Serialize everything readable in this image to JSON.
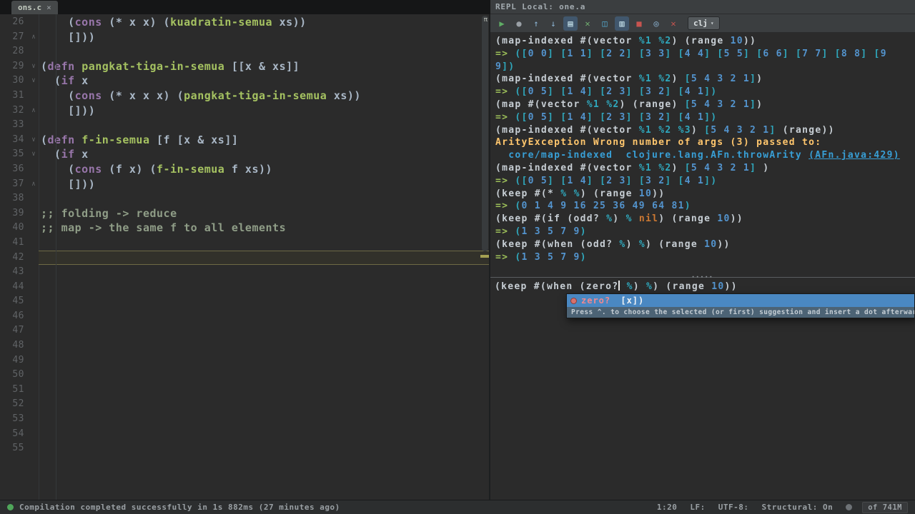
{
  "topbar": {
    "tab": {
      "label": "ons.c",
      "close": "×"
    }
  },
  "repl_header": {
    "title": "REPL Local: one.a"
  },
  "editor": {
    "lines": [
      {
        "n": 26,
        "seg": [
          [
            "    (",
            "d"
          ],
          [
            "cons",
            "kw"
          ],
          [
            " (* x x) (",
            "d"
          ],
          [
            "kuadratin-semua",
            "fn"
          ],
          [
            " xs))",
            "d"
          ]
        ]
      },
      {
        "n": 27,
        "f": "e",
        "seg": [
          [
            "    []))",
            "d"
          ]
        ]
      },
      {
        "n": 28
      },
      {
        "n": 29,
        "f": "s",
        "seg": [
          [
            "(",
            "d"
          ],
          [
            "defn",
            "kw"
          ],
          [
            " ",
            "d"
          ],
          [
            "pangkat-tiga-in-semua",
            "fn"
          ],
          [
            " [[x & xs]]",
            "d"
          ]
        ]
      },
      {
        "n": 30,
        "f": "s",
        "seg": [
          [
            "  (",
            "d"
          ],
          [
            "if",
            "kw"
          ],
          [
            " x",
            "d"
          ]
        ]
      },
      {
        "n": 31,
        "seg": [
          [
            "    (",
            "d"
          ],
          [
            "cons",
            "kw"
          ],
          [
            " (* x x x) (",
            "d"
          ],
          [
            "pangkat-tiga-in-semua",
            "fn"
          ],
          [
            " xs))",
            "d"
          ]
        ]
      },
      {
        "n": 32,
        "f": "e",
        "seg": [
          [
            "    []))",
            "d"
          ]
        ]
      },
      {
        "n": 33
      },
      {
        "n": 34,
        "f": "s",
        "seg": [
          [
            "(",
            "d"
          ],
          [
            "defn",
            "kw"
          ],
          [
            " ",
            "d"
          ],
          [
            "f-in-semua",
            "fn"
          ],
          [
            " [f [x & xs]]",
            "d"
          ]
        ]
      },
      {
        "n": 35,
        "f": "s",
        "seg": [
          [
            "  (",
            "d"
          ],
          [
            "if",
            "kw"
          ],
          [
            " x",
            "d"
          ]
        ]
      },
      {
        "n": 36,
        "seg": [
          [
            "    (",
            "d"
          ],
          [
            "cons",
            "kw"
          ],
          [
            " (f x) (",
            "d"
          ],
          [
            "f-in-semua",
            "fn"
          ],
          [
            " f xs))",
            "d"
          ]
        ]
      },
      {
        "n": 37,
        "f": "e",
        "seg": [
          [
            "    []))",
            "d"
          ]
        ]
      },
      {
        "n": 38
      },
      {
        "n": 39,
        "seg": [
          [
            ";; folding -> reduce",
            "cm"
          ]
        ]
      },
      {
        "n": 40,
        "seg": [
          [
            ";; map -> the same f to all elements",
            "cm"
          ]
        ]
      },
      {
        "n": 41
      },
      {
        "n": 42,
        "cur": true
      },
      {
        "n": 43
      },
      {
        "n": 44
      },
      {
        "n": 45
      },
      {
        "n": 46
      },
      {
        "n": 47
      },
      {
        "n": 48
      },
      {
        "n": 49
      },
      {
        "n": 50
      },
      {
        "n": 51
      },
      {
        "n": 52
      },
      {
        "n": 53
      },
      {
        "n": 54
      },
      {
        "n": 55
      }
    ]
  },
  "repl": {
    "toolbar": [
      {
        "name": "run-icon",
        "glyph": "▶",
        "color": "#5fad65"
      },
      {
        "name": "pause-icon",
        "glyph": "●",
        "color": "#9aa0a6"
      },
      {
        "name": "history-previous-icon",
        "glyph": "↑",
        "color": "#8fb8d8"
      },
      {
        "name": "history-next-icon",
        "glyph": "↓",
        "color": "#8fb8d8"
      },
      {
        "name": "execute-console-icon",
        "glyph": "▤",
        "color": "#cdeaf2",
        "active": true
      },
      {
        "name": "clear-repl-icon",
        "glyph": "✕",
        "color": "#72b172"
      },
      {
        "name": "trash-icon",
        "glyph": "◫",
        "color": "#55a8cc"
      },
      {
        "name": "soft-wrap-icon",
        "glyph": "▥",
        "color": "#cdeaf2",
        "active": true
      },
      {
        "name": "stop-icon",
        "glyph": "■",
        "color": "#c75450"
      },
      {
        "name": "scroll-to-end-icon",
        "glyph": "◎",
        "color": "#8fb8d8"
      },
      {
        "name": "close-icon",
        "glyph": "✕",
        "color": "#c75450"
      },
      {
        "name": "repl-language-select",
        "label": "clj",
        "arrow": "▾",
        "dropdown": true
      }
    ],
    "output": [
      {
        "seg": [
          [
            "(map-indexed #(vector ",
            "d"
          ],
          [
            "%1",
            "t"
          ],
          [
            " ",
            "d"
          ],
          [
            "%2",
            "t"
          ],
          [
            ") (range ",
            "d"
          ],
          [
            "10",
            "n"
          ],
          [
            "))",
            "d"
          ]
        ]
      },
      {
        "seg": [
          [
            "=> ",
            "g"
          ],
          [
            "([",
            "t"
          ],
          [
            "0 0",
            "n"
          ],
          [
            "] [",
            "t"
          ],
          [
            "1 1",
            "n"
          ],
          [
            "] [",
            "t"
          ],
          [
            "2 2",
            "n"
          ],
          [
            "] [",
            "t"
          ],
          [
            "3 3",
            "n"
          ],
          [
            "] [",
            "t"
          ],
          [
            "4 4",
            "n"
          ],
          [
            "] [",
            "t"
          ],
          [
            "5 5",
            "n"
          ],
          [
            "] [",
            "t"
          ],
          [
            "6 6",
            "n"
          ],
          [
            "] [",
            "t"
          ],
          [
            "7 7",
            "n"
          ],
          [
            "] [",
            "t"
          ],
          [
            "8 8",
            "n"
          ],
          [
            "] [",
            "t"
          ],
          [
            "9",
            "n"
          ]
        ]
      },
      {
        "seg": [
          [
            "9",
            "n"
          ],
          [
            "])",
            "t"
          ]
        ]
      },
      {
        "seg": [
          [
            "(map-indexed #(vector ",
            "d"
          ],
          [
            "%1",
            "t"
          ],
          [
            " ",
            "d"
          ],
          [
            "%2",
            "t"
          ],
          [
            ") ",
            "d"
          ],
          [
            "[",
            "t"
          ],
          [
            "5 4 3 2 1",
            "n"
          ],
          [
            "]",
            "t"
          ],
          [
            ")",
            "d"
          ]
        ]
      },
      {
        "seg": [
          [
            "=> ",
            "g"
          ],
          [
            "([",
            "t"
          ],
          [
            "0 5",
            "n"
          ],
          [
            "] [",
            "t"
          ],
          [
            "1 4",
            "n"
          ],
          [
            "] [",
            "t"
          ],
          [
            "2 3",
            "n"
          ],
          [
            "] [",
            "t"
          ],
          [
            "3 2",
            "n"
          ],
          [
            "] [",
            "t"
          ],
          [
            "4 1",
            "n"
          ],
          [
            "])",
            "t"
          ]
        ]
      },
      {
        "seg": [
          [
            "(map #(vector ",
            "d"
          ],
          [
            "%1",
            "t"
          ],
          [
            " ",
            "d"
          ],
          [
            "%2",
            "t"
          ],
          [
            ") (range) ",
            "d"
          ],
          [
            "[",
            "t"
          ],
          [
            "5 4 3 2 1",
            "n"
          ],
          [
            "]",
            "t"
          ],
          [
            ")",
            "d"
          ]
        ]
      },
      {
        "seg": [
          [
            "=> ",
            "g"
          ],
          [
            "([",
            "t"
          ],
          [
            "0 5",
            "n"
          ],
          [
            "] [",
            "t"
          ],
          [
            "1 4",
            "n"
          ],
          [
            "] [",
            "t"
          ],
          [
            "2 3",
            "n"
          ],
          [
            "] [",
            "t"
          ],
          [
            "3 2",
            "n"
          ],
          [
            "] [",
            "t"
          ],
          [
            "4 1",
            "n"
          ],
          [
            "])",
            "t"
          ]
        ]
      },
      {
        "seg": [
          [
            "(map-indexed #(vector ",
            "d"
          ],
          [
            "%1",
            "t"
          ],
          [
            " ",
            "d"
          ],
          [
            "%2",
            "t"
          ],
          [
            " ",
            "d"
          ],
          [
            "%3",
            "t"
          ],
          [
            ") ",
            "d"
          ],
          [
            "[",
            "t"
          ],
          [
            "5 4 3 2 1",
            "n"
          ],
          [
            "]",
            "t"
          ],
          [
            " (range))",
            "d"
          ]
        ]
      },
      {
        "seg": [
          [
            "ArityException Wrong number of args (3) passed to:",
            "y"
          ]
        ]
      },
      {
        "seg": [
          [
            "  core/map-indexed  clojure.lang.AFn.throwArity ",
            "c"
          ],
          [
            "(AFn.java:429)",
            "cu"
          ]
        ]
      },
      {
        "seg": [
          [
            "(map-indexed #(vector ",
            "d"
          ],
          [
            "%1",
            "t"
          ],
          [
            " ",
            "d"
          ],
          [
            "%2",
            "t"
          ],
          [
            ") ",
            "d"
          ],
          [
            "[",
            "t"
          ],
          [
            "5 4 3 2 1",
            "n"
          ],
          [
            "]",
            "t"
          ],
          [
            " )",
            "d"
          ]
        ]
      },
      {
        "seg": [
          [
            "=> ",
            "g"
          ],
          [
            "([",
            "t"
          ],
          [
            "0 5",
            "n"
          ],
          [
            "] [",
            "t"
          ],
          [
            "1 4",
            "n"
          ],
          [
            "] [",
            "t"
          ],
          [
            "2 3",
            "n"
          ],
          [
            "] [",
            "t"
          ],
          [
            "3 2",
            "n"
          ],
          [
            "] [",
            "t"
          ],
          [
            "4 1",
            "n"
          ],
          [
            "])",
            "t"
          ]
        ]
      },
      {
        "seg": [
          [
            "(keep #(* ",
            "d"
          ],
          [
            "%",
            "t"
          ],
          [
            " ",
            "d"
          ],
          [
            "%",
            "t"
          ],
          [
            ") (range ",
            "d"
          ],
          [
            "10",
            "n"
          ],
          [
            "))",
            "d"
          ]
        ]
      },
      {
        "seg": [
          [
            "=> ",
            "g"
          ],
          [
            "(",
            "t"
          ],
          [
            "0 1 4 9 16 25 36 49 64 81",
            "n"
          ],
          [
            ")",
            "t"
          ]
        ]
      },
      {
        "seg": [
          [
            "(keep #(if (odd? ",
            "d"
          ],
          [
            "%",
            "t"
          ],
          [
            ") ",
            "d"
          ],
          [
            "%",
            "t"
          ],
          [
            " ",
            "d"
          ],
          [
            "nil",
            "o"
          ],
          [
            ") (range ",
            "d"
          ],
          [
            "10",
            "n"
          ],
          [
            "))",
            "d"
          ]
        ]
      },
      {
        "seg": [
          [
            "=> ",
            "g"
          ],
          [
            "(",
            "t"
          ],
          [
            "1 3 5 7 9",
            "n"
          ],
          [
            ")",
            "t"
          ]
        ]
      },
      {
        "seg": [
          [
            "(keep #(when (odd? ",
            "d"
          ],
          [
            "%",
            "t"
          ],
          [
            ") ",
            "d"
          ],
          [
            "%",
            "t"
          ],
          [
            ") (range ",
            "d"
          ],
          [
            "10",
            "n"
          ],
          [
            "))",
            "d"
          ]
        ]
      },
      {
        "seg": [
          [
            "=> ",
            "g"
          ],
          [
            "(",
            "t"
          ],
          [
            "1 3 5 7 9",
            "n"
          ],
          [
            ")",
            "t"
          ]
        ]
      }
    ],
    "input": {
      "seg": [
        [
          "(keep #(when (zero?",
          "d"
        ],
        [
          "",
          "caret"
        ],
        [
          " ",
          "d"
        ],
        [
          "%",
          "t"
        ],
        [
          ") ",
          "d"
        ],
        [
          "%",
          "t"
        ],
        [
          ") (range ",
          "d"
        ],
        [
          "10",
          "n"
        ],
        [
          "))",
          "d"
        ]
      ]
    },
    "popup": {
      "suggestion": {
        "name_text": "zero?",
        "tail": " [x])"
      },
      "hint": "Press ^. to choose the selected (or first) suggestion and insert a dot afterwards"
    }
  },
  "status": {
    "left": "Compilation completed successfully in 1s 882ms (27 minutes ago)",
    "right": [
      "1:20",
      "LF:",
      "UTF-8:",
      "Structural: On"
    ],
    "memory": "of 741M"
  },
  "colors": {
    "background": "#2b2b2b",
    "toolbar_bg": "#3b3e40",
    "selection_blue": "#4a88c2",
    "error_yellow": "#ffc66d",
    "link_cyan": "#389fd6",
    "number_blue": "#5394ce",
    "teal": "#2fa8bd",
    "result_green": "#9cbf59",
    "keyword_purple": "#9876aa",
    "function_yellow": "#a5c261",
    "nil_orange": "#cc7832",
    "caret_line_border": "#6e6a45"
  }
}
